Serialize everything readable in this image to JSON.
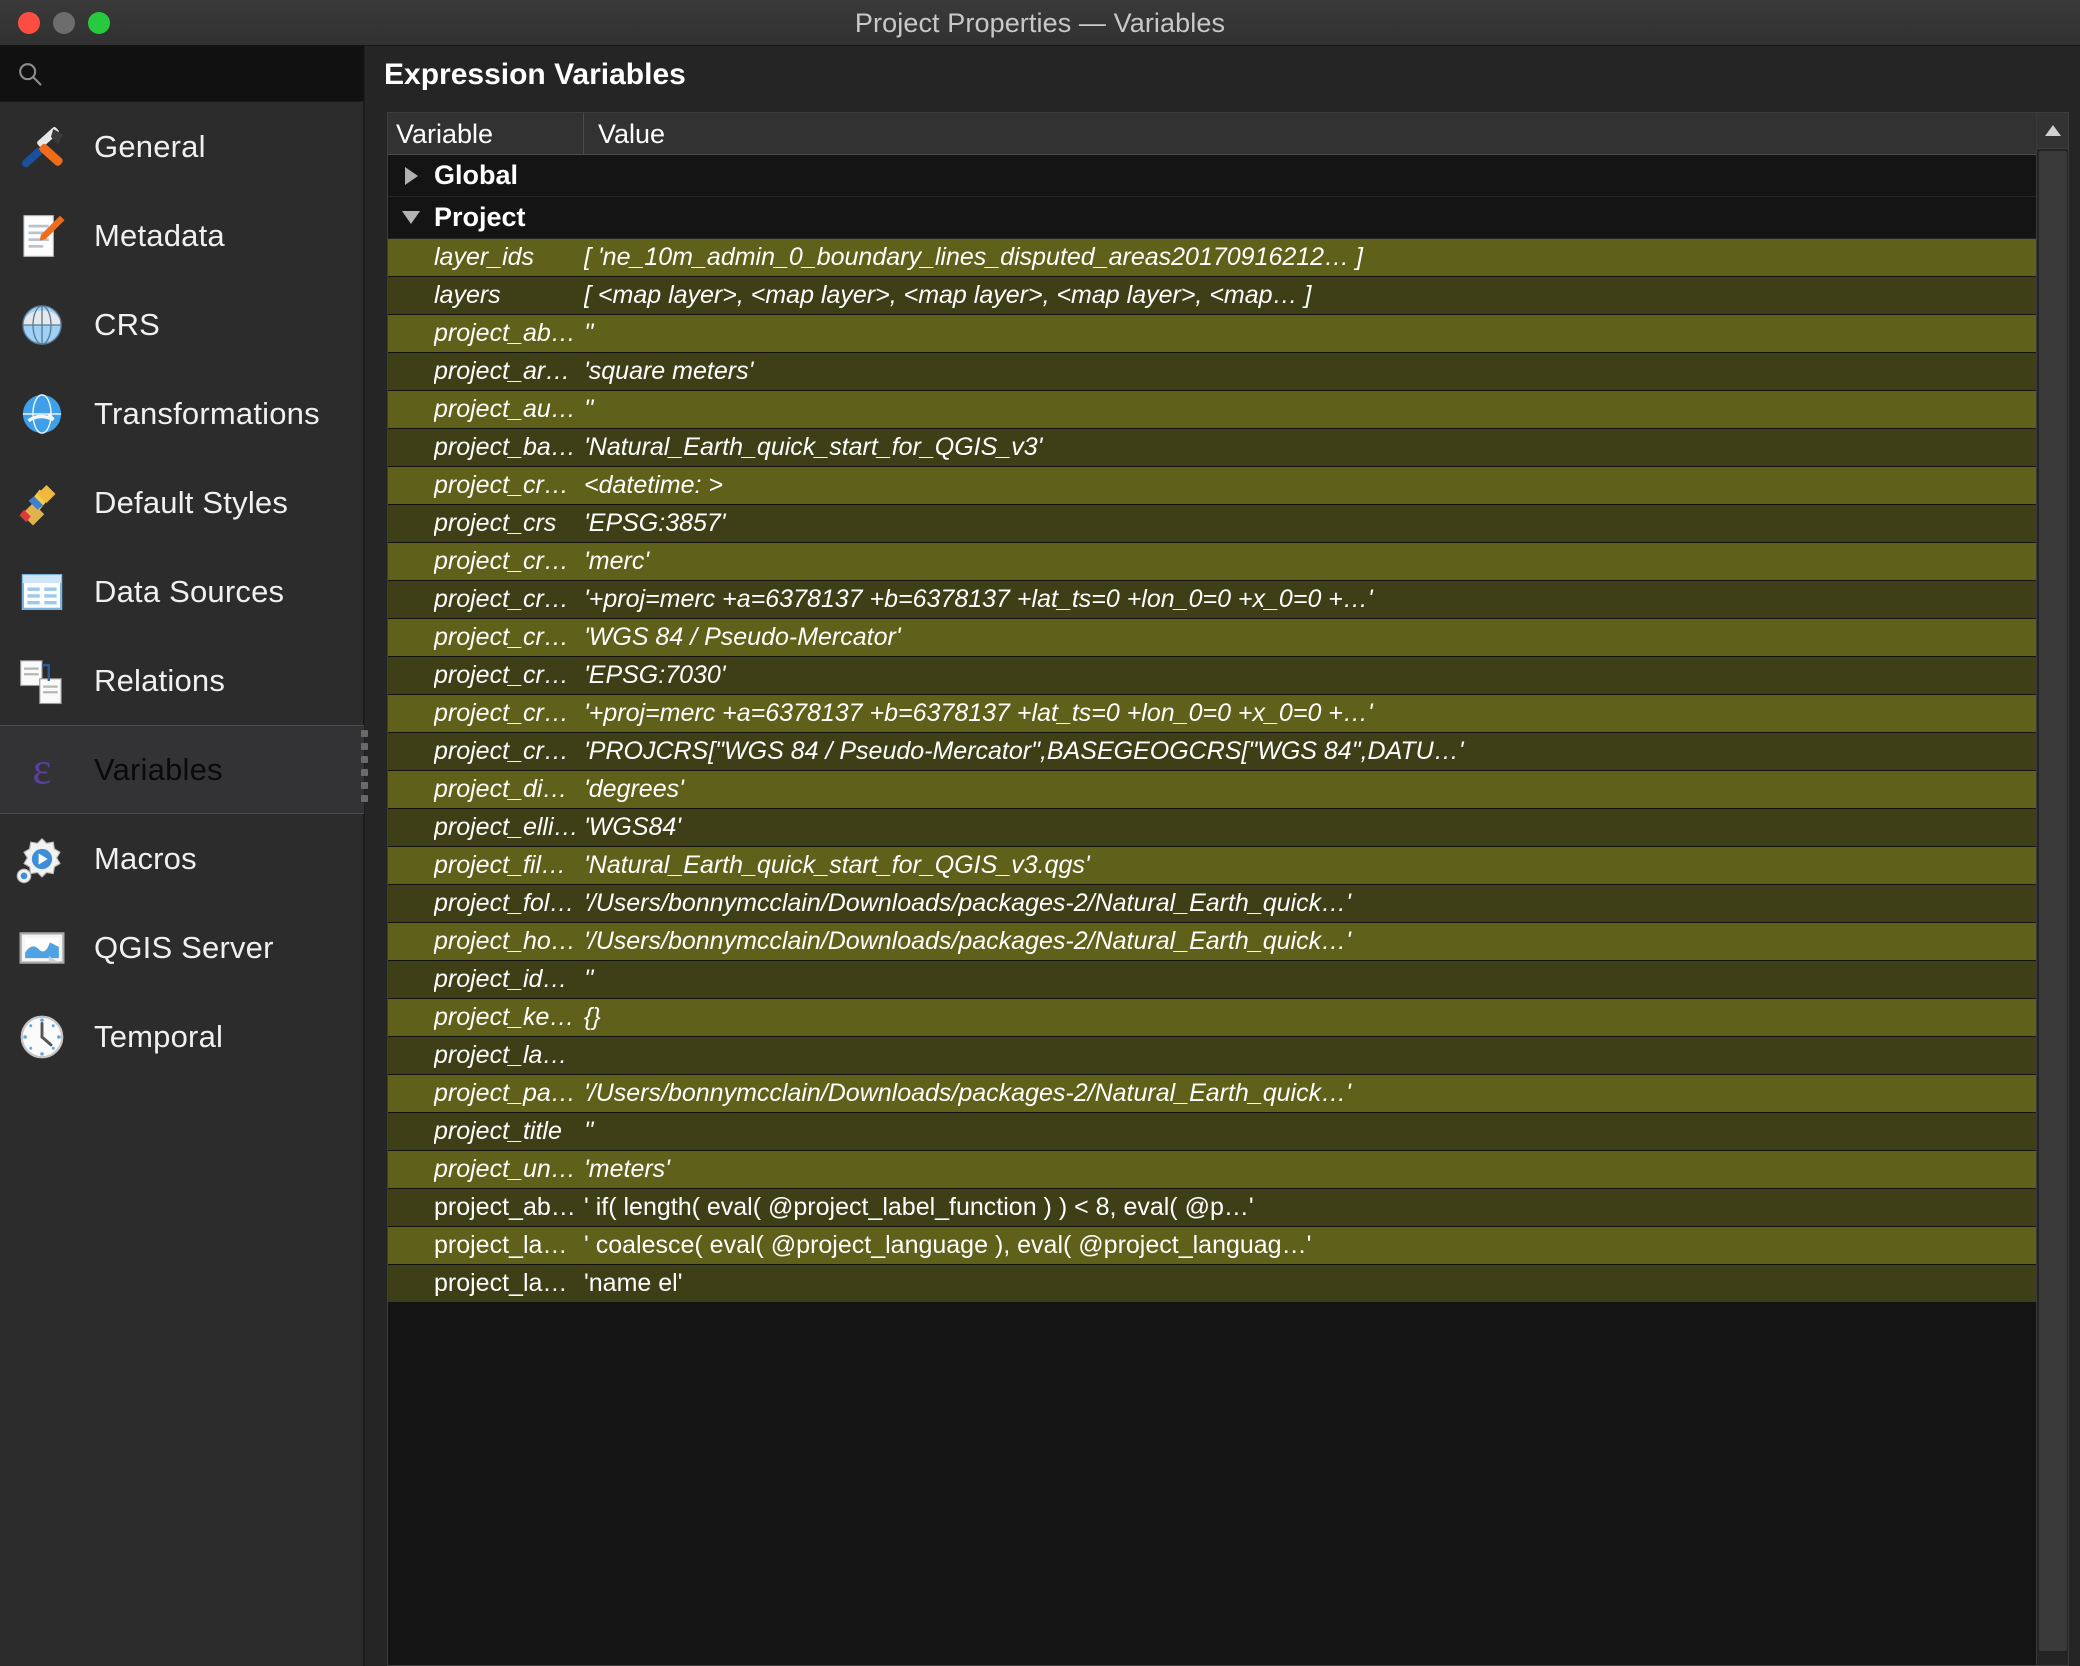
{
  "window": {
    "title": "Project Properties — Variables",
    "traffic_lights": [
      "close-button",
      "minimize-button",
      "maximize-button"
    ]
  },
  "sidebar": {
    "search": {
      "placeholder": "",
      "value": "",
      "icon": "search-icon"
    },
    "items": [
      {
        "label": "General",
        "icon": "tools-icon",
        "selected": false
      },
      {
        "label": "Metadata",
        "icon": "document-pencil-icon",
        "selected": false
      },
      {
        "label": "CRS",
        "icon": "globe-grid-icon",
        "selected": false
      },
      {
        "label": "Transformations",
        "icon": "globe-transform-icon",
        "selected": false
      },
      {
        "label": "Default Styles",
        "icon": "paintbrush-icon",
        "selected": false
      },
      {
        "label": "Data Sources",
        "icon": "table-icon",
        "selected": false
      },
      {
        "label": "Relations",
        "icon": "relations-icon",
        "selected": false
      },
      {
        "label": "Variables",
        "icon": "epsilon-icon",
        "selected": true
      },
      {
        "label": "Macros",
        "icon": "gear-play-icon",
        "selected": false
      },
      {
        "label": "QGIS Server",
        "icon": "server-map-icon",
        "selected": false
      },
      {
        "label": "Temporal",
        "icon": "clock-icon",
        "selected": false
      }
    ]
  },
  "main": {
    "pane_title": "Expression Variables",
    "table": {
      "columns": [
        "Variable",
        "Value"
      ],
      "groups": [
        {
          "name": "Global",
          "expanded": false,
          "twisty": "chevron-right-icon"
        },
        {
          "name": "Project",
          "expanded": true,
          "twisty": "chevron-down-icon"
        }
      ],
      "rows": [
        {
          "variable": "layer_ids",
          "value": "[ 'ne_10m_admin_0_boundary_lines_disputed_areas20170916212… ]",
          "italic": true
        },
        {
          "variable": "layers",
          "value": "[ <map layer>, <map layer>, <map layer>, <map layer>, <map… ]",
          "italic": true
        },
        {
          "variable": "project_ab…",
          "value": "''",
          "italic": true
        },
        {
          "variable": "project_ar…",
          "value": "'square meters'",
          "italic": true
        },
        {
          "variable": "project_au…",
          "value": "''",
          "italic": true
        },
        {
          "variable": "project_ba…",
          "value": "'Natural_Earth_quick_start_for_QGIS_v3'",
          "italic": true
        },
        {
          "variable": "project_cr…",
          "value": "<datetime: >",
          "italic": true
        },
        {
          "variable": "project_crs",
          "value": "'EPSG:3857'",
          "italic": true
        },
        {
          "variable": "project_cr…",
          "value": "'merc'",
          "italic": true
        },
        {
          "variable": "project_cr…",
          "value": "'+proj=merc +a=6378137 +b=6378137 +lat_ts=0 +lon_0=0 +x_0=0 +…'",
          "italic": true
        },
        {
          "variable": "project_cr…",
          "value": "'WGS 84 / Pseudo-Mercator'",
          "italic": true
        },
        {
          "variable": "project_cr…",
          "value": "'EPSG:7030'",
          "italic": true
        },
        {
          "variable": "project_cr…",
          "value": "'+proj=merc +a=6378137 +b=6378137 +lat_ts=0 +lon_0=0 +x_0=0 +…'",
          "italic": true
        },
        {
          "variable": "project_cr…",
          "value": "'PROJCRS[\"WGS 84 / Pseudo-Mercator\",BASEGEOGCRS[\"WGS 84\",DATU…'",
          "italic": true
        },
        {
          "variable": "project_di…",
          "value": "'degrees'",
          "italic": true
        },
        {
          "variable": "project_elli…",
          "value": "'WGS84'",
          "italic": true
        },
        {
          "variable": "project_fil…",
          "value": "'Natural_Earth_quick_start_for_QGIS_v3.qgs'",
          "italic": true
        },
        {
          "variable": "project_fol…",
          "value": "'/Users/bonnymcclain/Downloads/packages-2/Natural_Earth_quick…'",
          "italic": true
        },
        {
          "variable": "project_ho…",
          "value": "'/Users/bonnymcclain/Downloads/packages-2/Natural_Earth_quick…'",
          "italic": true
        },
        {
          "variable": "project_id…",
          "value": "''",
          "italic": true
        },
        {
          "variable": "project_ke…",
          "value": "{}",
          "italic": true
        },
        {
          "variable": "project_la…",
          "value": "",
          "italic": true
        },
        {
          "variable": "project_pa…",
          "value": "'/Users/bonnymcclain/Downloads/packages-2/Natural_Earth_quick…'",
          "italic": true
        },
        {
          "variable": "project_title",
          "value": "''",
          "italic": true
        },
        {
          "variable": "project_un…",
          "value": "'meters'",
          "italic": true
        },
        {
          "variable": "project_ab…",
          "value": "' if( length( eval( @project_label_function ) ) < 8, eval( @p…'",
          "italic": false
        },
        {
          "variable": "project_la…",
          "value": "' coalesce( eval( @project_language ), eval( @project_languag…'",
          "italic": false
        },
        {
          "variable": "project_la…",
          "value": "'name el'",
          "italic": false
        }
      ]
    },
    "scrollbar": {
      "up_arrow_icon": "caret-up-icon"
    }
  },
  "colors": {
    "row_odd": "#5f6019",
    "row_even": "#3e3f17",
    "sidebar_bg": "#2c2c2c",
    "selected_nav_bg": "#333335",
    "table_bg": "#141415",
    "titlebar_bg": "#343434"
  }
}
